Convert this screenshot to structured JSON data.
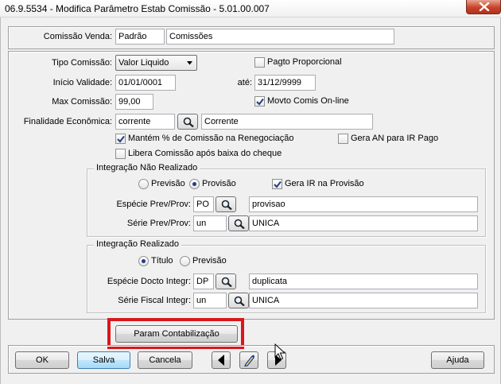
{
  "window": {
    "title": "06.9.5534 - Modifica Parâmetro Estab Comissão - 5.01.00.007"
  },
  "header": {
    "comissao_venda_label": "Comissão Venda:",
    "comissao_code": "Padrão",
    "comissao_desc": "Comissões"
  },
  "form": {
    "tipo_comissao_label": "Tipo Comissão:",
    "tipo_comissao_value": "Valor Liquido",
    "pagto_proporcional_label": "Pagto Proporcional",
    "pagto_proporcional_checked": false,
    "inicio_validade_label": "Início Validade:",
    "inicio_validade_value": "01/01/0001",
    "ate_label": "até:",
    "ate_value": "31/12/9999",
    "max_comissao_label": "Max Comissão:",
    "max_comissao_value": "99,00",
    "movto_comis_label": "Movto Comis On-line",
    "movto_comis_checked": true,
    "finalidade_label": "Finalidade Econômica:",
    "finalidade_code": "corrente",
    "finalidade_desc": "Corrente",
    "mantem_label": "Mantém % de Comissão na Renegociação",
    "mantem_checked": true,
    "gera_an_label": "Gera AN para IR Pago",
    "gera_an_checked": false,
    "libera_label": "Libera Comissão após baixa do cheque",
    "libera_checked": false
  },
  "integ_nao_realizado": {
    "title": "Integração Não Realizado",
    "radio_previsao_label": "Previsão",
    "radio_provisao_label": "Provisão",
    "selected": "Provisão",
    "gera_ir_label": "Gera IR na Provisão",
    "gera_ir_checked": true,
    "especie_label": "Espécie Prev/Prov:",
    "especie_code": "PO",
    "especie_desc": "provisao",
    "serie_label": "Série Prev/Prov:",
    "serie_code": "un",
    "serie_desc": "UNICA"
  },
  "integ_realizado": {
    "title": "Integração Realizado",
    "radio_titulo_label": "Título",
    "radio_previsao_label": "Previsão",
    "selected": "Título",
    "especie_label": "Espécie Docto Integr:",
    "especie_code": "DP",
    "especie_desc": "duplicata",
    "serie_label": "Série Fiscal Integr:",
    "serie_code": "un",
    "serie_desc": "UNICA"
  },
  "param_button_label": "Param Contabilização",
  "footer": {
    "ok_label": "OK",
    "salva_label": "Salva",
    "cancela_label": "Cancela",
    "ajuda_label": "Ajuda"
  },
  "colors": {
    "highlight": "#d9171d",
    "window_bg": "#f0f0f0"
  },
  "icons": [
    "close-icon",
    "search-icon",
    "arrow-left-icon",
    "arrow-right-icon",
    "pencil-icon",
    "dropdown-arrow-icon",
    "checkmark-icon"
  ]
}
